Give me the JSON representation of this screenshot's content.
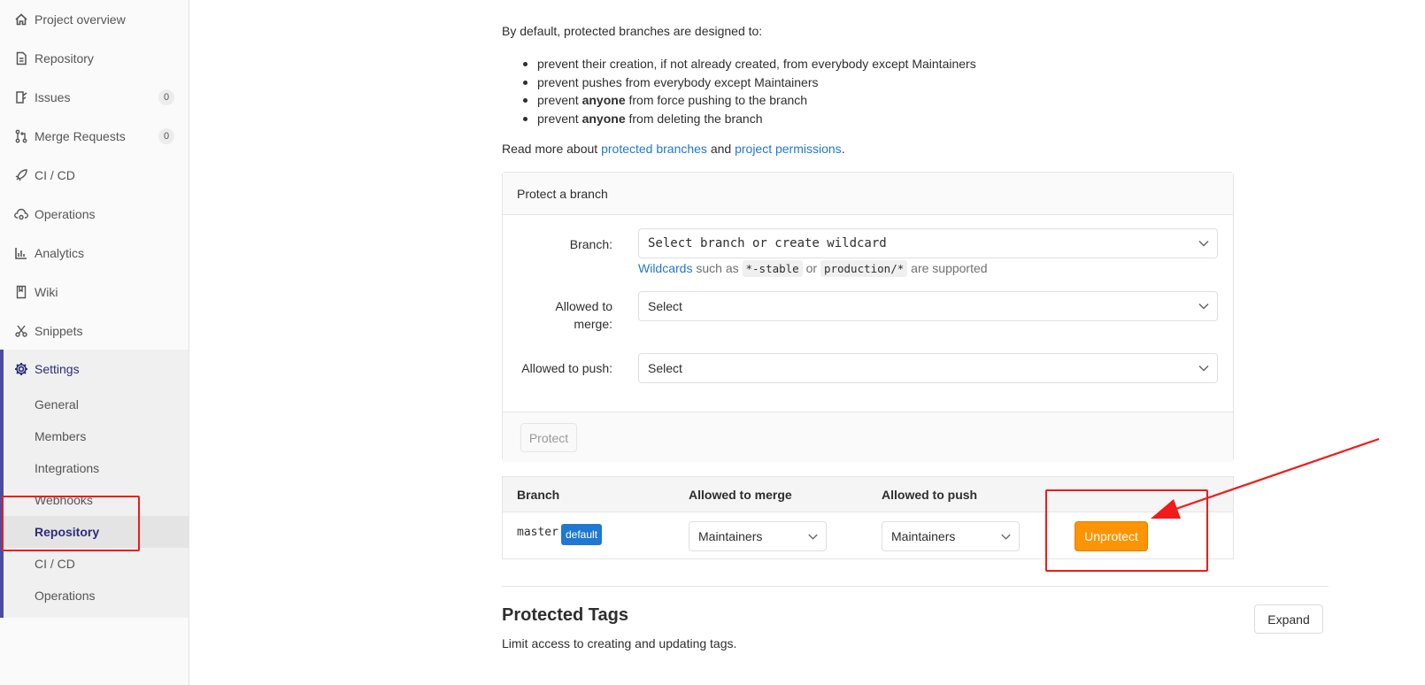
{
  "sidebar": {
    "items": [
      {
        "label": "Project overview",
        "icon": "home-icon"
      },
      {
        "label": "Repository",
        "icon": "document-icon"
      },
      {
        "label": "Issues",
        "icon": "issues-icon",
        "count": "0"
      },
      {
        "label": "Merge Requests",
        "icon": "merge-request-icon",
        "count": "0"
      },
      {
        "label": "CI / CD",
        "icon": "rocket-icon"
      },
      {
        "label": "Operations",
        "icon": "cloud-gear-icon"
      },
      {
        "label": "Analytics",
        "icon": "chart-icon"
      },
      {
        "label": "Wiki",
        "icon": "book-icon"
      },
      {
        "label": "Snippets",
        "icon": "scissors-icon"
      }
    ],
    "settings": {
      "label": "Settings",
      "icon": "gear-icon",
      "sub_items": [
        "General",
        "Members",
        "Integrations",
        "Webhooks",
        "Repository",
        "CI / CD",
        "Operations"
      ],
      "active": "Repository"
    }
  },
  "main": {
    "intro": "By default, protected branches are designed to:",
    "rules": [
      {
        "pre": "prevent their creation, if not already created, from everybody except Maintainers",
        "bold": "",
        "post": ""
      },
      {
        "pre": "prevent pushes from everybody except Maintainers",
        "bold": "",
        "post": ""
      },
      {
        "pre": "prevent ",
        "bold": "anyone",
        "post": " from force pushing to the branch"
      },
      {
        "pre": "prevent ",
        "bold": "anyone",
        "post": " from deleting the branch"
      }
    ],
    "read_more": {
      "prefix": "Read more about ",
      "link1": "protected branches",
      "middle": " and ",
      "link2": "project permissions",
      "suffix": "."
    },
    "protect_form": {
      "title": "Protect a branch",
      "branch_label": "Branch:",
      "branch_placeholder": "Select branch or create wildcard",
      "help_link": "Wildcards",
      "help_text1": " such as ",
      "code1": "*-stable",
      "help_text2": " or ",
      "code2": "production/*",
      "help_text3": " are supported",
      "merge_label": "Allowed to merge:",
      "merge_value": "Select",
      "push_label": "Allowed to push:",
      "push_value": "Select",
      "protect_button": "Protect"
    },
    "table": {
      "headers": [
        "Branch",
        "Allowed to merge",
        "Allowed to push"
      ],
      "rows": [
        {
          "branch": "master",
          "badge": "default",
          "merge": "Maintainers",
          "push": "Maintainers",
          "action": "Unprotect"
        }
      ]
    },
    "protected_tags": {
      "title": "Protected Tags",
      "description": "Limit access to creating and updating tags.",
      "expand_button": "Expand"
    }
  },
  "colors": {
    "accent": "#1f78d1",
    "unprotect_button": "#fc9403",
    "annotation": "#f21a1a",
    "settings_bar": "#4b4ba3"
  }
}
